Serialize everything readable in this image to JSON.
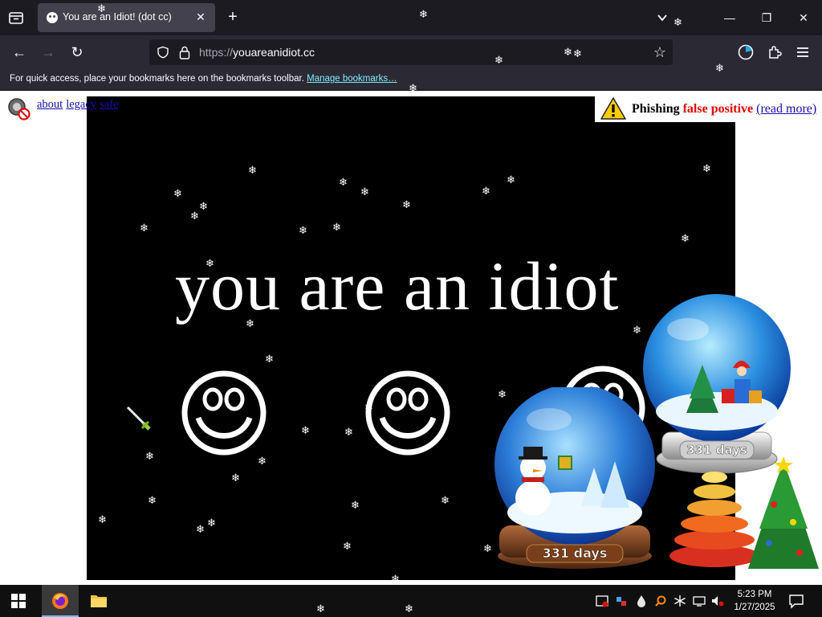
{
  "browser": {
    "tab": {
      "title": "You are an Idiot! (dot cc)",
      "close_glyph": "✕"
    },
    "new_tab_glyph": "+",
    "window_controls": {
      "minimize": "—",
      "restore": "❐",
      "close": "✕"
    },
    "nav": {
      "back": "←",
      "forward": "→",
      "reload": "↻"
    },
    "url": {
      "scheme": "https://",
      "host": "youareanidiot.cc"
    },
    "bookmark_star": "☆",
    "bookmarks_bar": {
      "message": "For quick access, place your bookmarks here on the bookmarks toolbar.",
      "link": "Manage bookmarks…"
    },
    "toolbar_icons": [
      "clock-icon",
      "extensions-icon",
      "menu-icon"
    ]
  },
  "page": {
    "top_links": [
      "about",
      "legacy",
      "safe"
    ],
    "phishing_banner": {
      "label": "Phishing",
      "status": "false positive",
      "link": "(read more)",
      "colors": {
        "status": "#e00000",
        "link": "#1a0dab"
      }
    },
    "headline": "you are an idiot",
    "smiley_count": 3,
    "globes": [
      {
        "label": "331 days",
        "scene": "christmas-tree-presents"
      },
      {
        "label": "331 days",
        "scene": "snowman-trees"
      }
    ],
    "colors": {
      "stage": "#000000",
      "text": "#ffffff"
    }
  },
  "taskbar": {
    "apps": [
      "firefox-icon",
      "file-explorer-icon"
    ],
    "clock": {
      "time": "5:23 PM",
      "date": "1/27/2025"
    }
  }
}
